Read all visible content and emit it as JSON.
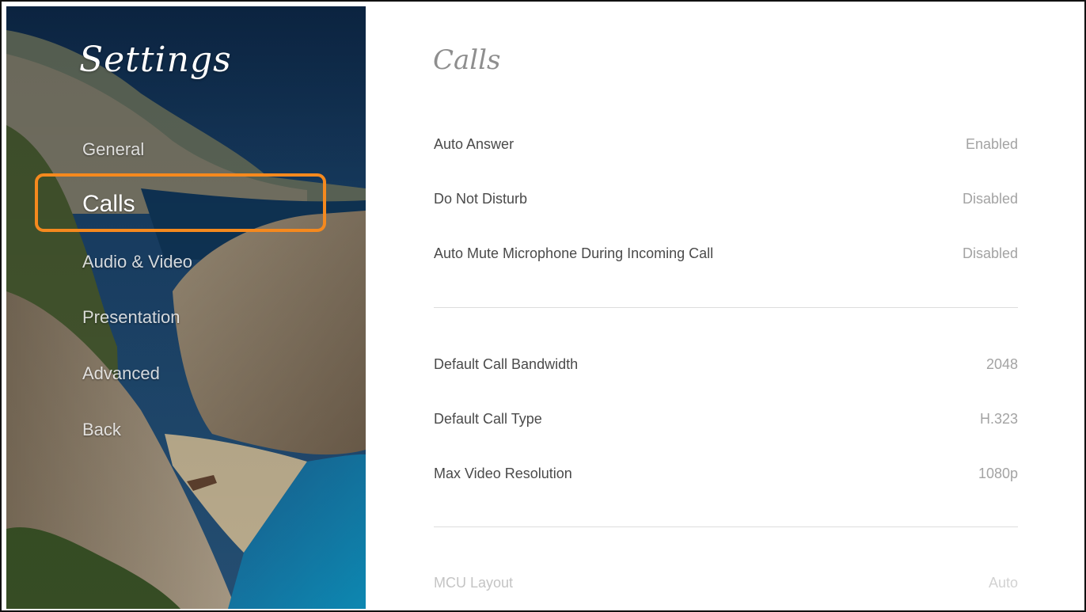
{
  "sidebar": {
    "title": "Settings",
    "items": [
      {
        "label": "General"
      },
      {
        "label": "Calls"
      },
      {
        "label": "Audio & Video"
      },
      {
        "label": "Presentation"
      },
      {
        "label": "Advanced"
      },
      {
        "label": "Back"
      }
    ],
    "selected": "Calls",
    "focus_color": "#f5891e"
  },
  "main": {
    "title": "Calls",
    "group1": [
      {
        "label": "Auto Answer",
        "value": "Enabled"
      },
      {
        "label": "Do Not Disturb",
        "value": "Disabled"
      },
      {
        "label": "Auto Mute Microphone During Incoming Call",
        "value": "Disabled"
      }
    ],
    "group2": [
      {
        "label": "Default Call Bandwidth",
        "value": "2048"
      },
      {
        "label": "Default Call Type",
        "value": "H.323"
      },
      {
        "label": "Max Video Resolution",
        "value": "1080p"
      }
    ],
    "group3": [
      {
        "label": "MCU Layout",
        "value": "Auto"
      }
    ]
  }
}
